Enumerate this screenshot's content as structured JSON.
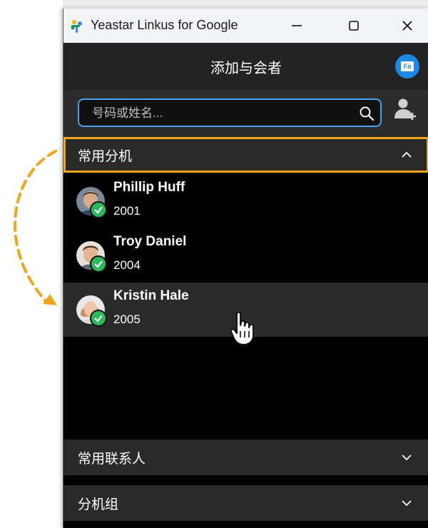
{
  "window": {
    "title": "Yeastar Linkus for Google",
    "controls": [
      "minimize",
      "maximize",
      "close"
    ]
  },
  "header": {
    "title": "添加与会者",
    "account_badge": "Fa"
  },
  "search": {
    "placeholder": "号码或姓名..."
  },
  "sections": {
    "extensions": {
      "label": "常用分机",
      "expanded": true
    },
    "contacts": {
      "label": "常用联系人",
      "expanded": false
    },
    "groups": {
      "label": "分机组",
      "expanded": false
    }
  },
  "extensions": [
    {
      "name": "Phillip Huff",
      "number": "2001",
      "status": "available"
    },
    {
      "name": "Troy Daniel",
      "number": "2004",
      "status": "available"
    },
    {
      "name": "Kristin Hale",
      "number": "2005",
      "status": "available"
    }
  ],
  "colors": {
    "accent": "#1e88e5",
    "highlight_border": "#f2a51b",
    "status_available": "#2eb85c",
    "background": "#000000"
  }
}
